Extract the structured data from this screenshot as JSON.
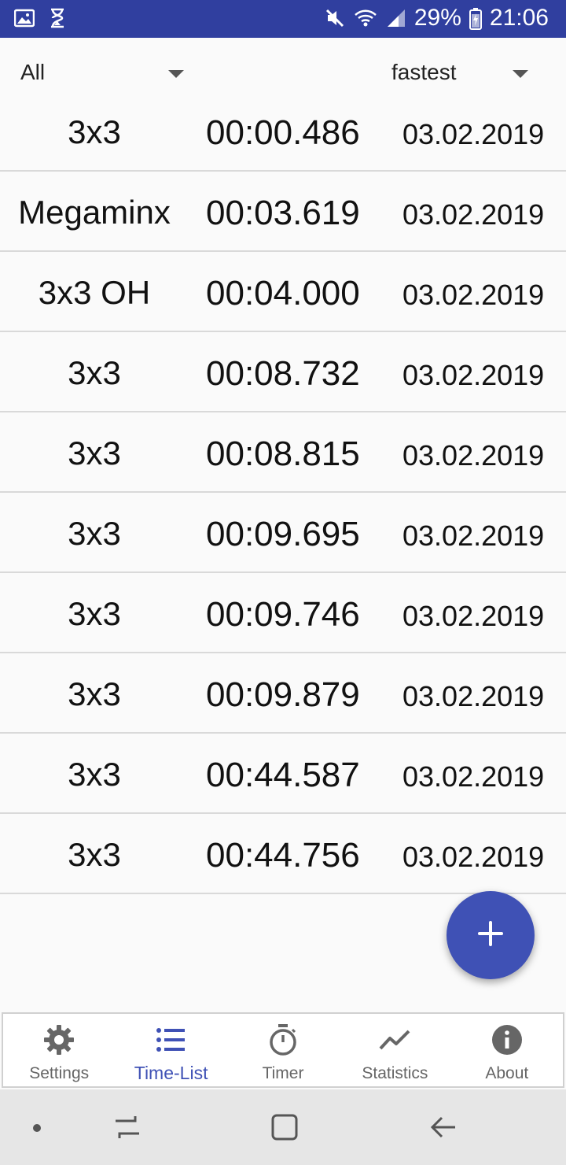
{
  "status_bar": {
    "battery": "29%",
    "time": "21:06",
    "icons": [
      "gallery-icon",
      "hourglass-icon",
      "mute-icon",
      "wifi-icon",
      "signal-icon",
      "battery-icon"
    ]
  },
  "filters": {
    "category": "All",
    "sort": "fastest"
  },
  "solves": [
    {
      "event": "3x3",
      "time": "00:00.486",
      "date": "03.02.2019"
    },
    {
      "event": "Megaminx",
      "time": "00:03.619",
      "date": "03.02.2019"
    },
    {
      "event": "3x3 OH",
      "time": "00:04.000",
      "date": "03.02.2019"
    },
    {
      "event": "3x3",
      "time": "00:08.732",
      "date": "03.02.2019"
    },
    {
      "event": "3x3",
      "time": "00:08.815",
      "date": "03.02.2019"
    },
    {
      "event": "3x3",
      "time": "00:09.695",
      "date": "03.02.2019"
    },
    {
      "event": "3x3",
      "time": "00:09.746",
      "date": "03.02.2019"
    },
    {
      "event": "3x3",
      "time": "00:09.879",
      "date": "03.02.2019"
    },
    {
      "event": "3x3",
      "time": "00:44.587",
      "date": "03.02.2019"
    },
    {
      "event": "3x3",
      "time": "00:44.756",
      "date": "03.02.2019"
    }
  ],
  "fab": {
    "icon": "plus-icon"
  },
  "bottom_nav": {
    "active": "Time-List",
    "tabs": [
      {
        "label": "Settings",
        "icon": "gear-icon"
      },
      {
        "label": "Time-List",
        "icon": "list-icon"
      },
      {
        "label": "Timer",
        "icon": "stopwatch-icon"
      },
      {
        "label": "Statistics",
        "icon": "chart-line-icon"
      },
      {
        "label": "About",
        "icon": "info-icon"
      }
    ]
  },
  "colors": {
    "primary": "#3f51b5",
    "status_bar": "#303f9f",
    "inactive_icon": "#666666"
  }
}
